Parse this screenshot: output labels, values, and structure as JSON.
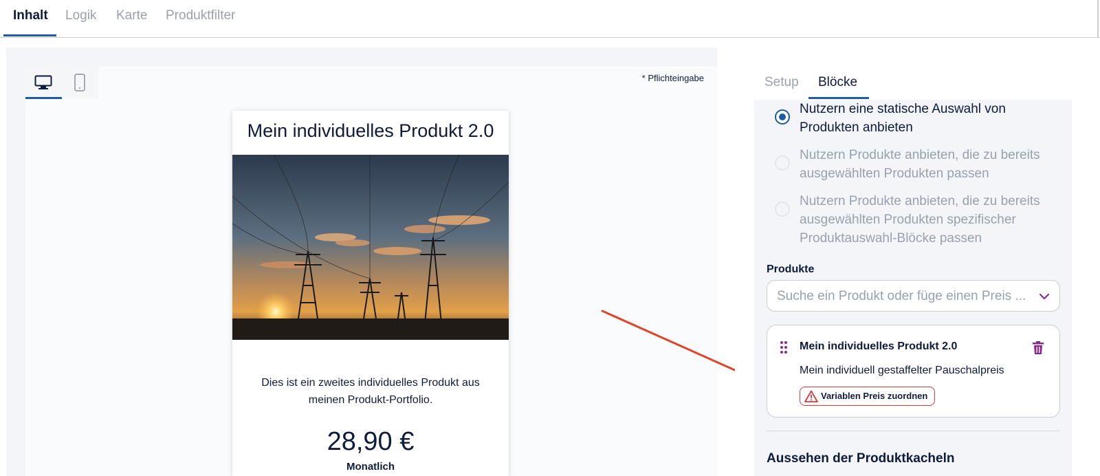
{
  "top_tabs": [
    {
      "label": "Inhalt",
      "active": true
    },
    {
      "label": "Logik",
      "active": false
    },
    {
      "label": "Karte",
      "active": false
    },
    {
      "label": "Produktfilter",
      "active": false
    }
  ],
  "preview": {
    "required_note": "* Pflichteingabe",
    "devices": [
      {
        "icon": "desktop-icon",
        "active": true
      },
      {
        "icon": "mobile-icon",
        "active": false
      }
    ],
    "card": {
      "title": "Mein individuelles Produkt 2.0",
      "image": "power-lines-sunset",
      "description": "Dies ist ein zweites individuelles Produkt aus meinen Produkt-Portfolio.",
      "price": "28,90 €",
      "period": "Monatlich"
    }
  },
  "panel": {
    "tabs": [
      {
        "label": "Setup",
        "active": false
      },
      {
        "label": "Blöcke",
        "active": true
      }
    ],
    "radio_options": [
      {
        "label": "Nutzern eine statische Auswahl von Produkten anbieten",
        "selected": true
      },
      {
        "label": "Nutzern Produkte anbieten, die zu bereits ausgewählten Produkten passen",
        "selected": false
      },
      {
        "label": "Nutzern Produkte anbieten, die zu bereits ausgewählten Produkten spezifischer Produktauswahl-Blöcke passen",
        "selected": false
      }
    ],
    "products_label": "Produkte",
    "products_placeholder": "Suche ein Produkt oder füge einen Preis ...",
    "selected_product": {
      "title": "Mein individuelles Produkt 2.0",
      "subtitle": "Mein individuell gestaffelter Pauschalpreis",
      "warning_label": "Variablen Preis zuordnen"
    },
    "section_heading": "Aussehen der Produktkacheln"
  },
  "colors": {
    "accent": "#1f5aa8",
    "text": "#0f1b3d",
    "muted": "#9aa0ad",
    "warning": "#d93a3a",
    "trash": "#8a2a8f",
    "annotation_arrow": "#e0452b"
  }
}
